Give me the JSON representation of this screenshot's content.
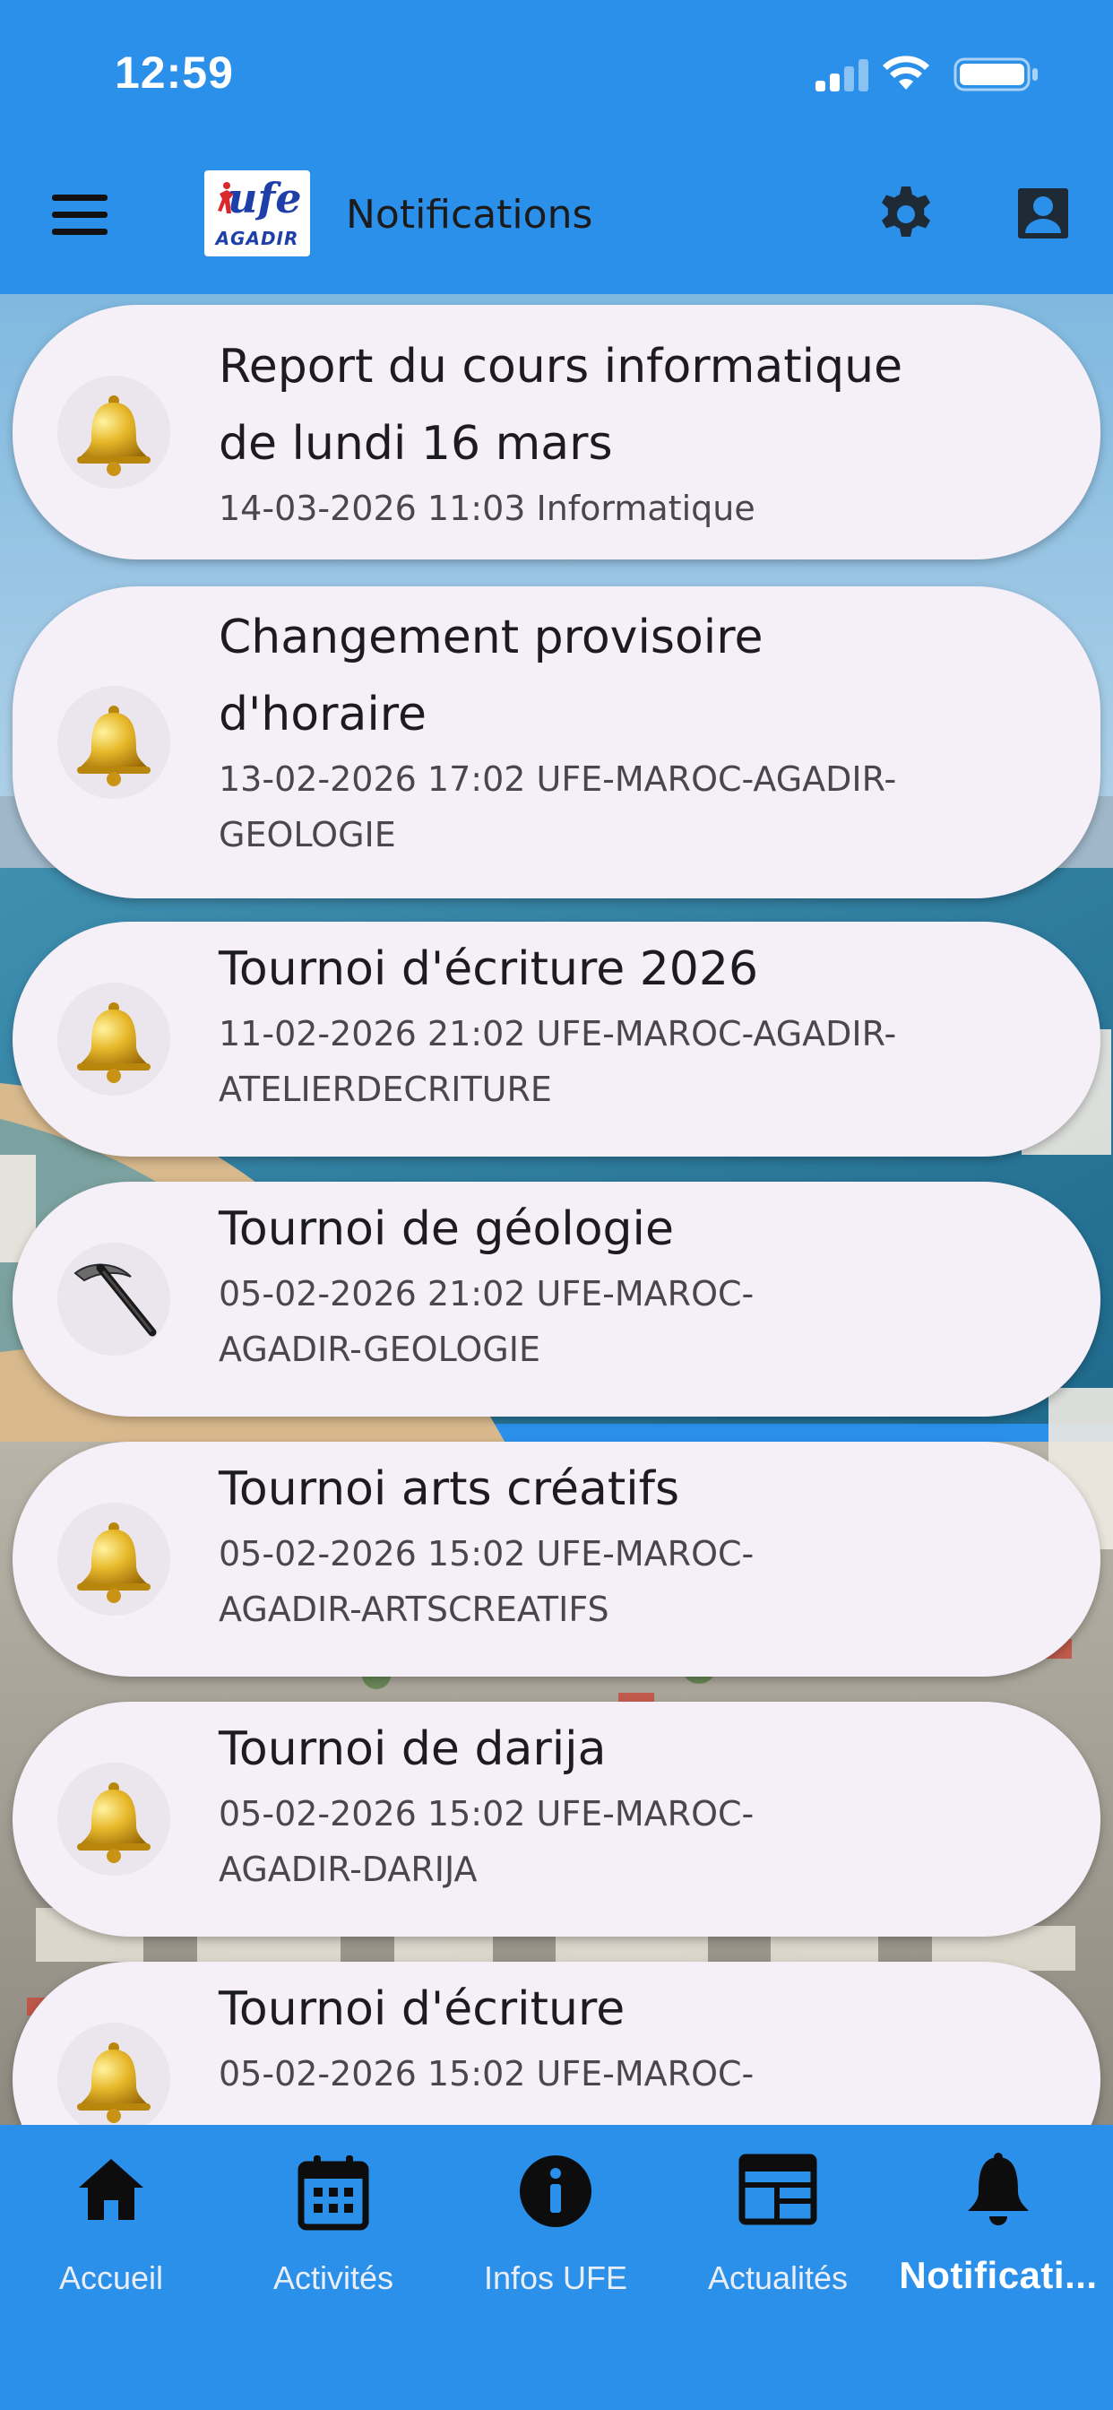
{
  "status_bar": {
    "time": "12:59"
  },
  "header": {
    "title": "Notifications",
    "logo_text": "ufe",
    "logo_subtext": "AGADIR"
  },
  "notifications": [
    {
      "title_lines": [
        "Report du cours informatique",
        "de lundi 16 mars"
      ],
      "meta_lines": [
        "14-03-2026 11:03  Informatique"
      ],
      "icon": "bell-icon"
    },
    {
      "title_lines": [
        "Changement provisoire",
        "d'horaire"
      ],
      "meta_lines": [
        "13-02-2026 17:02  UFE-MAROC-AGADIR-",
        "GEOLOGIE"
      ],
      "icon": "bell-icon"
    },
    {
      "title_lines": [
        "Tournoi d'écriture 2026"
      ],
      "meta_lines": [
        "11-02-2026 21:02  UFE-MAROC-AGADIR-",
        "ATELIERDECRITURE"
      ],
      "icon": "bell-icon"
    },
    {
      "title_lines": [
        "Tournoi de géologie"
      ],
      "meta_lines": [
        "05-02-2026 21:02  UFE-MAROC-",
        "AGADIR-GEOLOGIE"
      ],
      "icon": "pickaxe-icon"
    },
    {
      "title_lines": [
        "Tournoi arts créatifs"
      ],
      "meta_lines": [
        "05-02-2026 15:02  UFE-MAROC-",
        "AGADIR-ARTSCREATIFS"
      ],
      "icon": "bell-icon"
    },
    {
      "title_lines": [
        "Tournoi de darija"
      ],
      "meta_lines": [
        "05-02-2026 15:02  UFE-MAROC-",
        "AGADIR-DARIJA"
      ],
      "icon": "bell-icon"
    },
    {
      "title_lines": [
        "Tournoi d'écriture"
      ],
      "meta_lines": [
        "05-02-2026 15:02  UFE-MAROC-"
      ],
      "icon": "bell-icon"
    }
  ],
  "bottom_nav": [
    {
      "label": "Accueil",
      "icon": "home-icon",
      "active": false
    },
    {
      "label": "Activités",
      "icon": "calendar-icon",
      "active": false
    },
    {
      "label": "Infos UFE",
      "icon": "info-icon",
      "active": false
    },
    {
      "label": "Actualités",
      "icon": "newspaper-icon",
      "active": false
    },
    {
      "label": "Notificati...",
      "icon": "bell-icon",
      "active": true
    }
  ],
  "colors": {
    "primary": "#2b90ea",
    "card": "#f5eff7",
    "text": "#1c1b1f",
    "subtext": "#4a4650"
  }
}
